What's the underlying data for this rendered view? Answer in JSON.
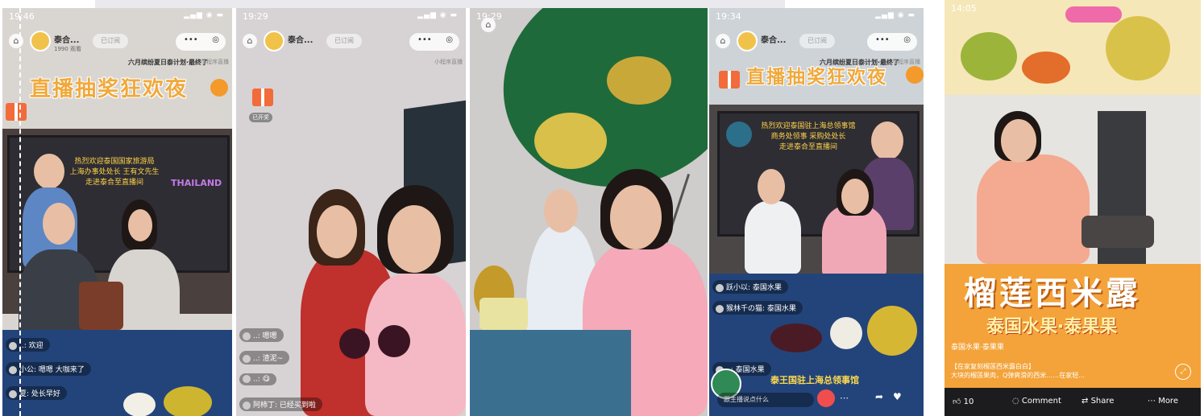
{
  "panel1": {
    "time": "19:46",
    "shop_name": "泰合...",
    "shop_sub": "1990 观看",
    "follow": "已订阅",
    "subtitle": "六月缤纷夏日泰计划·最终了",
    "mini": "小程序直播",
    "title": "直播抽奖狂欢夜",
    "screen_text": [
      "热烈欢迎泰国国家旅游局",
      "上海办事处处长 王有文先生",
      "走进泰合至直播间"
    ],
    "screen_badge": "THAILAND",
    "comments": [
      "..: 欢迎",
      "小公: 嗯嗯 大咖来了",
      "夏: 处长早好"
    ]
  },
  "panel2": {
    "time": "19:29",
    "shop_name": "泰合...",
    "follow": "已订阅",
    "mini": "小程序直播",
    "gift_label": "已开奖",
    "comments": [
      "..: 嗯嗯",
      "..: 渣泥~",
      "..: 😋",
      "阿柿丁: 已经买到啦"
    ]
  },
  "panel3": {
    "time": "19:29"
  },
  "panel4": {
    "time": "19:34",
    "shop_name": "泰合...",
    "follow": "已订阅",
    "subtitle": "六月缤纷夏日泰计划·最终了",
    "mini": "小程序直播",
    "title": "直播抽奖狂欢夜",
    "screen_text": [
      "热烈欢迎泰国驻上海总领事馆",
      "商务处领事 采购处处长",
      "走进泰合至直播间"
    ],
    "comments": [
      "跃小以: 泰国水果",
      "猴林千の猫: 泰国水果",
      "..: 泰国水果"
    ],
    "consulate": "泰王国驻上海总领事馆",
    "input_placeholder": "跟主播说点什么"
  },
  "panel5": {
    "time": "14:05",
    "dish_title": "榴莲西米露",
    "brand": "泰国水果·泰果果",
    "page_name": "泰国水果·泰果果",
    "caption_line1": "【在家复刻榴莲西米露白白】",
    "caption_line2": "大块的榴莲果肉，Q弹爽滑的西米……在家轻...",
    "likes": "10",
    "comment": "Comment",
    "share": "Share",
    "more": "More"
  },
  "colors": {
    "title_orange": "#f0a93b",
    "table_blue": "#23447a",
    "welcome_yellow": "#ffd34a",
    "banner_orange": "#f3a33a"
  }
}
